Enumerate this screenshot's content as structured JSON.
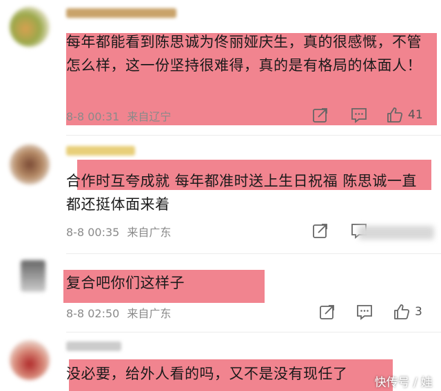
{
  "comments": [
    {
      "text": "每年都能看到陈思诚为佟丽娅庆生，真的很感慨，不管怎么样，这一份坚持很难得，真的是有格局的体面人！",
      "time": "8-8 00:31",
      "location": "来自辽宁",
      "likes": "41"
    },
    {
      "text": "合作时互夸成就 每年都准时送上生日祝福 陈思诚一直都还挺体面来着",
      "time": "8-8 00:35",
      "location": "来自广东"
    },
    {
      "text": "复合吧你们这样子",
      "time": "8-8 02:50",
      "location": "来自广东",
      "likes": "3"
    },
    {
      "text": "没必要，给外人看的吗，又不是没有现任了"
    }
  ],
  "watermark": "快传号 / 娃",
  "colors": {
    "highlight": "#f07a86",
    "meta": "#8a8a8a",
    "icon": "#666666"
  },
  "icons": [
    "share-icon",
    "comment-icon",
    "like-icon"
  ]
}
